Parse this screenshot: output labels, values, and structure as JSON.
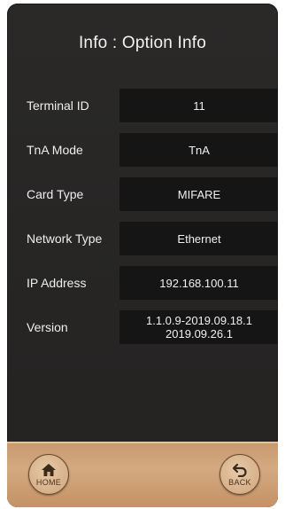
{
  "header": {
    "title": "Info : Option Info"
  },
  "info": [
    {
      "label": "Terminal ID",
      "value": [
        "11"
      ]
    },
    {
      "label": "TnA Mode",
      "value": [
        "TnA"
      ]
    },
    {
      "label": "Card Type",
      "value": [
        "MIFARE"
      ]
    },
    {
      "label": "Network Type",
      "value": [
        "Ethernet"
      ]
    },
    {
      "label": "IP Address",
      "value": [
        "192.168.100.11"
      ]
    },
    {
      "label": "Version",
      "value": [
        "1.1.0.9-2019.09.18.1",
        "2019.09.26.1"
      ]
    }
  ],
  "footer": {
    "home": {
      "label": "HOME",
      "icon": "home-icon"
    },
    "back": {
      "label": "BACK",
      "icon": "back-arrow-icon"
    }
  },
  "colors": {
    "background": "#262524",
    "field": "#151515",
    "footer": "#d4a981",
    "text": "#f0f0f0"
  }
}
